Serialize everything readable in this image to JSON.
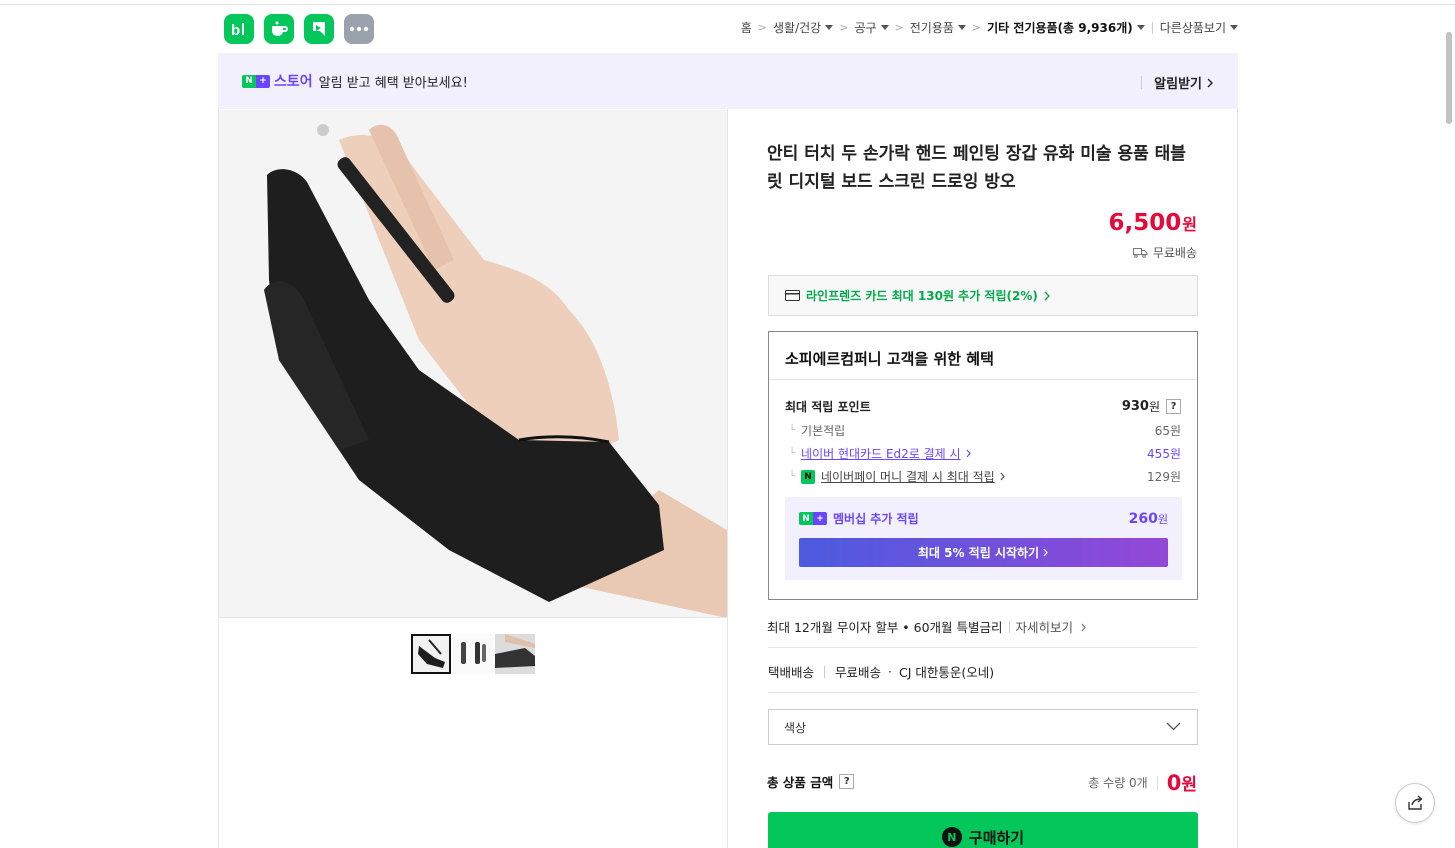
{
  "header": {
    "apps": [
      {
        "name": "blog-app-icon"
      },
      {
        "name": "cafe-app-icon"
      },
      {
        "name": "kboard-app-icon"
      },
      {
        "name": "more-app-icon"
      }
    ],
    "breadcrumbs": [
      {
        "label": "홈",
        "dropdown": false
      },
      {
        "label": "생활/건강",
        "dropdown": true
      },
      {
        "label": "공구",
        "dropdown": true
      },
      {
        "label": "전기용품",
        "dropdown": true
      },
      {
        "label": "기타 전기용품(총 9,936개)",
        "dropdown": true,
        "bold": true
      }
    ],
    "other_products": "다른상품보기"
  },
  "banner": {
    "badge_n": "N",
    "badge_plus": "+",
    "store": "스토어",
    "text": "알림 받고 혜택 받아보세요!",
    "action": "알림받기"
  },
  "product": {
    "title": "안티 터치 두 손가락 핸드 페인팅 장갑 유화 미술 용품 태블릿 디지털 보드 스크린 드로잉 방오",
    "price": "6,500",
    "currency": "원",
    "shipping": "무료배송",
    "thumbnails": [
      "thumb-1",
      "thumb-2",
      "thumb-3"
    ]
  },
  "card_promo": "라인프렌즈 카드 최대 130원 추가 적립(2%)",
  "benefit": {
    "title": "소피에르컴퍼니 고객을 위한 혜택",
    "max_points_label": "최대 적립 포인트",
    "max_points_value": "930",
    "rows": [
      {
        "label": "기본적립",
        "value": "65원"
      },
      {
        "label": "네이버 현대카드 Ed2로 결제 시",
        "value": "455원"
      },
      {
        "label": "네이버페이 머니 결제 시 최대 적립",
        "value": "129원"
      }
    ],
    "membership_label": "멤버십 추가 적립",
    "membership_value": "260",
    "membership_button": "최대 5% 적립 시작하기"
  },
  "installment": {
    "text": "최대 12개월 무이자 할부 • 60개월 특별금리",
    "link": "자세히보기"
  },
  "delivery": {
    "type": "택배배송",
    "fee": "무료배송",
    "courier": "CJ 대한통운(오네)"
  },
  "option_select": {
    "placeholder": "색상"
  },
  "total": {
    "label": "총 상품 금액",
    "qty": "총 수량 0개",
    "amount": "0",
    "currency": "원"
  },
  "buy_button": "구매하기",
  "colors": {
    "naver_green": "#03c75a",
    "price_red": "#e60a3a",
    "membership_purple": "#6a45ff"
  }
}
